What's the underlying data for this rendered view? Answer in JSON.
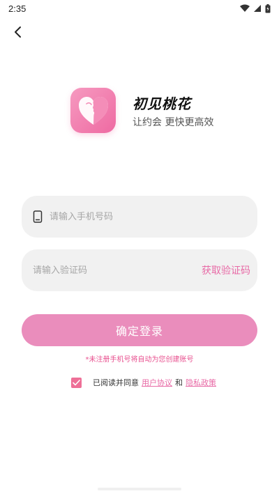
{
  "status_bar": {
    "time": "2:35"
  },
  "header": {
    "back_icon": "chevron-left-icon"
  },
  "brand": {
    "app_name": "初见桃花",
    "slogan": "让约会 更快更高效",
    "accent_color": "#ee6aa2"
  },
  "phone_input": {
    "placeholder": "请输入手机号码",
    "value": "",
    "icon": "phone-icon"
  },
  "code_input": {
    "placeholder": "请输入验证码",
    "value": "",
    "get_code_label": "获取验证码"
  },
  "login_button": {
    "label": "确定登录",
    "color": "#ea8dbc"
  },
  "hint": "*未注册手机号将自动为您创建账号",
  "agreement": {
    "checked": true,
    "prefix": "已阅读并同意",
    "user_agreement": "用户协议",
    "conjunction": "和",
    "privacy_policy": "隐私政策"
  }
}
